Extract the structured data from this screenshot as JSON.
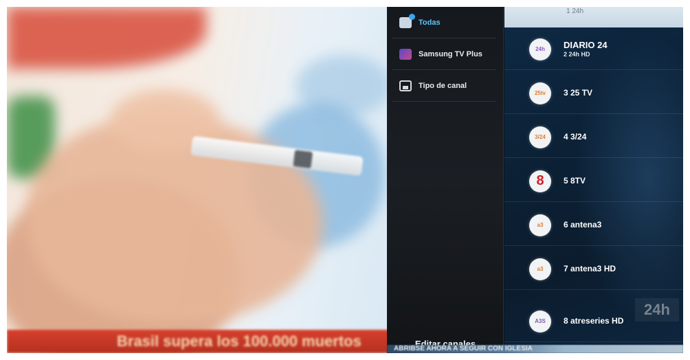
{
  "menu": {
    "items": [
      {
        "label": "Todas",
        "icon": "all-channels-icon"
      },
      {
        "label": "Samsung TV Plus",
        "icon": "tv-plus-icon"
      },
      {
        "label": "Tipo de canal",
        "icon": "channel-type-icon"
      }
    ],
    "footer": "Editar canales"
  },
  "list": {
    "top_partial": "1 24h",
    "watermark": "24h",
    "channels": [
      {
        "name": "DIARIO 24",
        "number_label": "2 24h HD",
        "logo": "24h"
      },
      {
        "label": "3 25 TV",
        "logo": "25tv"
      },
      {
        "label": "4 3/24",
        "logo": "3/24"
      },
      {
        "label": "5 8TV",
        "logo": "8"
      },
      {
        "label": "6 antena3",
        "logo": "a3"
      },
      {
        "label": "7 antena3 HD",
        "logo": "a3"
      },
      {
        "label": "8 atreseries HD",
        "logo": "A3S"
      }
    ]
  },
  "video": {
    "ticker_text": "Brasil supera los 100.000 muertos",
    "bottom_strip_text": "ABRIBSE AHORA A SEGUIR CON IGLESIA"
  },
  "colors": {
    "accent": "#5ec3ff",
    "menu_bg": "#1b1f24",
    "list_bg": "#0c2136",
    "ticker_bg": "#c23a28"
  }
}
